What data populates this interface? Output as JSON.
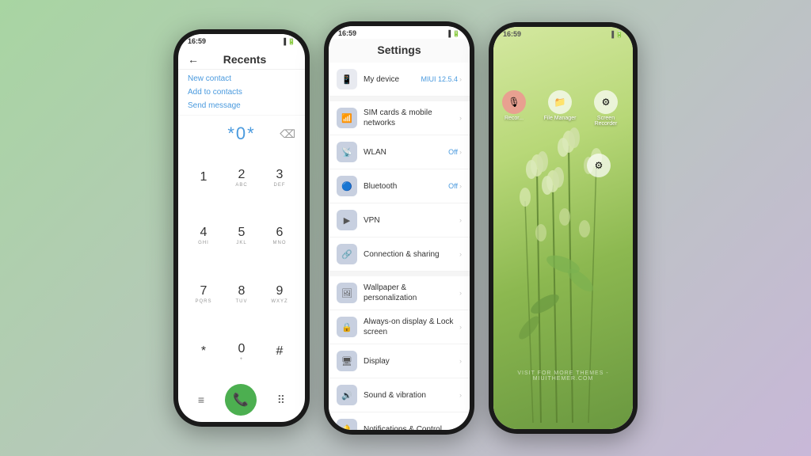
{
  "background": {
    "gradient_start": "#a8d5a2",
    "gradient_end": "#c8b8d8"
  },
  "phone1": {
    "status_time": "16:59",
    "title": "Recents",
    "actions": [
      "New contact",
      "Add to contacts",
      "Send message"
    ],
    "dialer_display": "*0*",
    "keys": [
      {
        "num": "1",
        "sub": ""
      },
      {
        "num": "2",
        "sub": "ABC"
      },
      {
        "num": "3",
        "sub": "DEF"
      },
      {
        "num": "4",
        "sub": "GHI"
      },
      {
        "num": "5",
        "sub": "JKL"
      },
      {
        "num": "6",
        "sub": "MNO"
      },
      {
        "num": "7",
        "sub": "PQRS"
      },
      {
        "num": "8",
        "sub": "TUV"
      },
      {
        "num": "9",
        "sub": "WXYZ"
      },
      {
        "num": "*",
        "sub": ""
      },
      {
        "num": "0",
        "sub": "+"
      },
      {
        "num": "#",
        "sub": ""
      }
    ]
  },
  "phone2": {
    "status_time": "16:59",
    "title": "Settings",
    "items": [
      {
        "icon": "📱",
        "title": "My device",
        "sub": "",
        "value": "MIUI 12.5.4",
        "arrow": true
      },
      {
        "icon": "📶",
        "title": "SIM cards & mobile networks",
        "sub": "",
        "value": "",
        "arrow": true
      },
      {
        "icon": "📡",
        "title": "WLAN",
        "sub": "",
        "value": "Off",
        "arrow": true
      },
      {
        "icon": "🔵",
        "title": "Bluetooth",
        "sub": "",
        "value": "Off",
        "arrow": true
      },
      {
        "icon": "▶",
        "title": "VPN",
        "sub": "",
        "value": "",
        "arrow": true
      },
      {
        "icon": "🔗",
        "title": "Connection & sharing",
        "sub": "",
        "value": "",
        "arrow": true
      },
      {
        "icon": "🖼",
        "title": "Wallpaper & personalization",
        "sub": "",
        "value": "",
        "arrow": true
      },
      {
        "icon": "🔒",
        "title": "Always-on display & Lock screen",
        "sub": "",
        "value": "",
        "arrow": true
      },
      {
        "icon": "🖥",
        "title": "Display",
        "sub": "",
        "value": "",
        "arrow": true
      },
      {
        "icon": "🔊",
        "title": "Sound & vibration",
        "sub": "",
        "value": "",
        "arrow": true
      },
      {
        "icon": "🔔",
        "title": "Notifications & Control",
        "sub": "",
        "value": "",
        "arrow": true
      }
    ]
  },
  "phone3": {
    "status_time": "16:59",
    "icons": [
      {
        "label": "Recor...",
        "accent": true
      },
      {
        "label": "File Manager",
        "accent": false
      },
      {
        "label": "Screen Recorder",
        "accent": false
      }
    ],
    "icon_row2": {
      "label": ""
    },
    "watermark": "VISIT FOR MORE THEMES - MIUITHEMER.COM"
  }
}
